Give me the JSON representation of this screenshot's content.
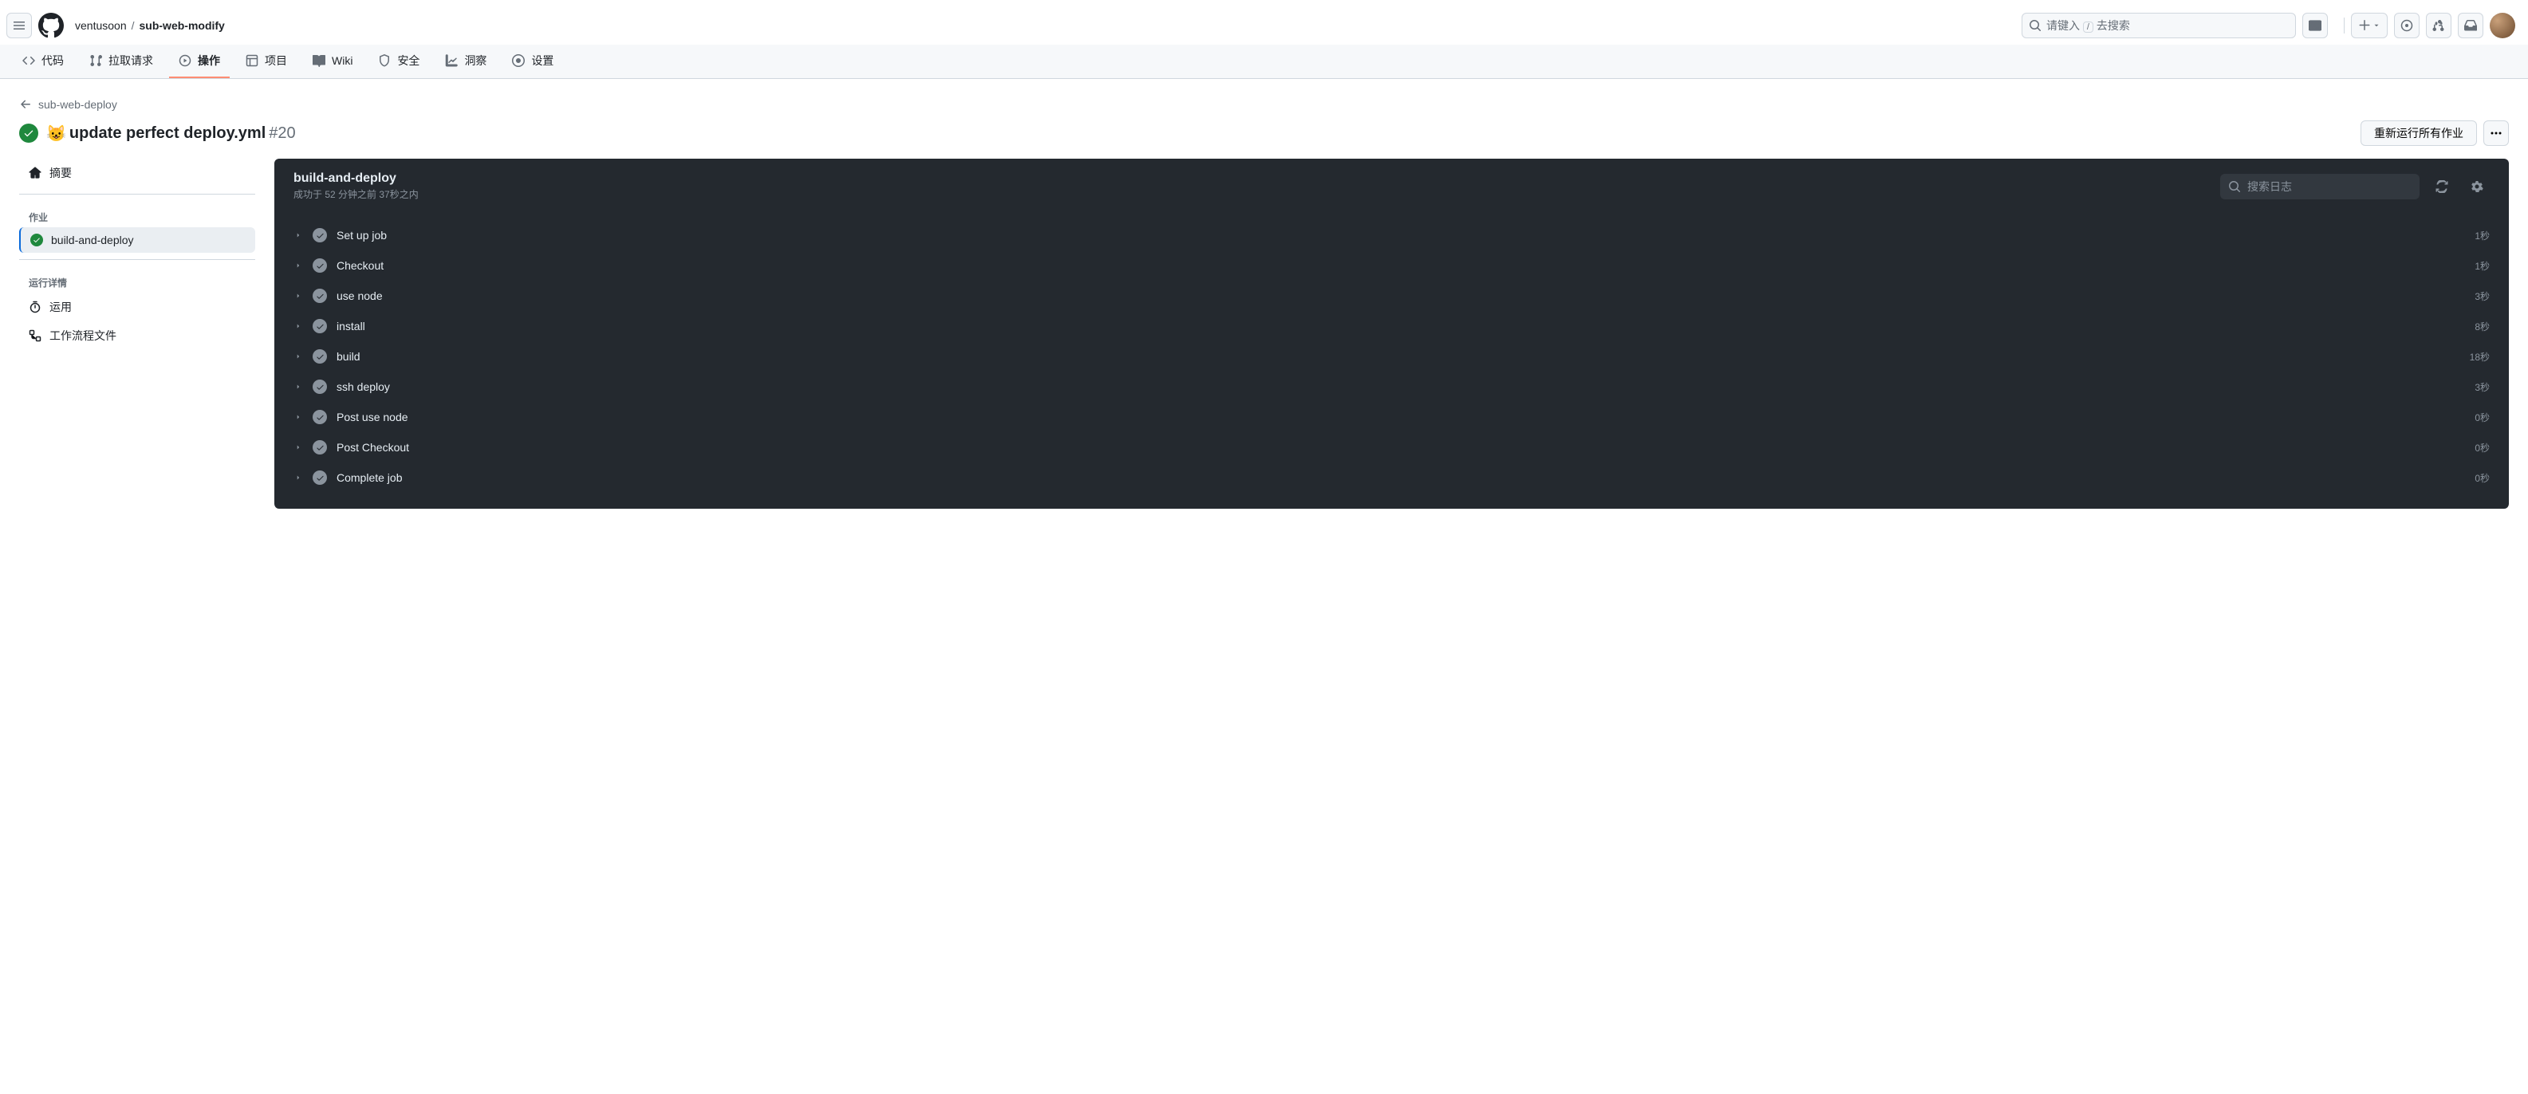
{
  "header": {
    "owner": "ventusoon",
    "repo": "sub-web-modify",
    "search_placeholder_prefix": "请键入 ",
    "search_placeholder_suffix": " 去搜索",
    "search_key": "/"
  },
  "repo_nav": [
    {
      "label": "代码"
    },
    {
      "label": "拉取请求"
    },
    {
      "label": "操作"
    },
    {
      "label": "项目"
    },
    {
      "label": "Wiki"
    },
    {
      "label": "安全"
    },
    {
      "label": "洞察"
    },
    {
      "label": "设置"
    }
  ],
  "back_link": "sub-web-deploy",
  "run": {
    "emoji": "😺",
    "title": "update perfect deploy.yml",
    "number": "#20",
    "rerun_button": "重新运行所有作业"
  },
  "sidebar": {
    "summary": "摘要",
    "jobs_heading": "作业",
    "job_name": "build-and-deploy",
    "details_heading": "运行详情",
    "usage": "运用",
    "workflow_file": "工作流程文件"
  },
  "log_panel": {
    "job_name": "build-and-deploy",
    "status_line": "成功于 52 分钟之前 37秒之内",
    "search_placeholder": "搜索日志"
  },
  "steps": [
    {
      "name": "Set up job",
      "duration": "1秒"
    },
    {
      "name": "Checkout",
      "duration": "1秒"
    },
    {
      "name": "use node",
      "duration": "3秒"
    },
    {
      "name": "install",
      "duration": "8秒"
    },
    {
      "name": "build",
      "duration": "18秒"
    },
    {
      "name": "ssh deploy",
      "duration": "3秒"
    },
    {
      "name": "Post use node",
      "duration": "0秒"
    },
    {
      "name": "Post Checkout",
      "duration": "0秒"
    },
    {
      "name": "Complete job",
      "duration": "0秒"
    }
  ]
}
